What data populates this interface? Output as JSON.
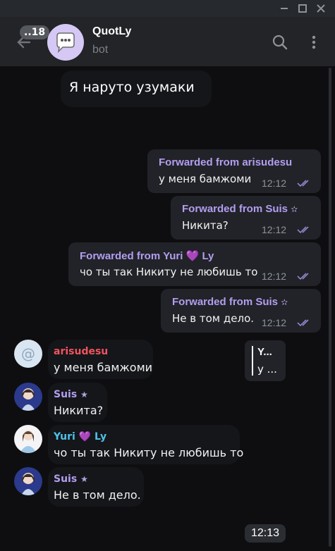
{
  "header": {
    "unread_count": "..18",
    "title": "QuotLy",
    "subtitle": "bot"
  },
  "sticker": {
    "text": "Я наруто узумаки"
  },
  "forwards": [
    {
      "from": "Forwarded from arisudesu",
      "text": "у меня бамжоми",
      "time": "12:12"
    },
    {
      "from": "Forwarded from Suis",
      "star": "✫",
      "text": "Никита?",
      "time": "12:12"
    },
    {
      "from": "Forwarded from Yuri",
      "heart": "💜",
      "from_suffix": "Ly",
      "text": "чо ты так Никиту не любишь то",
      "time": "12:12"
    },
    {
      "from": "Forwarded from Suis",
      "star": "✫",
      "text": "Не в том дело.",
      "time": "12:12"
    }
  ],
  "reply_preview": {
    "title": "Y...",
    "text": "у ..."
  },
  "quote_sticker": [
    {
      "avatar": "@",
      "name": "arisudesu",
      "name_color": "#f0545e",
      "text": "у меня бамжоми"
    },
    {
      "name": "Suis",
      "star": "★",
      "name_color": "#b39ef0",
      "text": "Никита?"
    },
    {
      "name": "Yuri",
      "heart": "💜",
      "name_suffix": "Ly",
      "name_color": "#4fc1e9",
      "text": "чо ты так Никиту не любишь то"
    },
    {
      "name": "Suis",
      "star": "★",
      "name_color": "#b39ef0",
      "text": "Не в том дело."
    }
  ],
  "sticker_time": "12:13",
  "colors": {
    "background": "#0e0e10",
    "accent": "#b39ef0",
    "bubble": "#212328",
    "check": "#8b85c9"
  }
}
